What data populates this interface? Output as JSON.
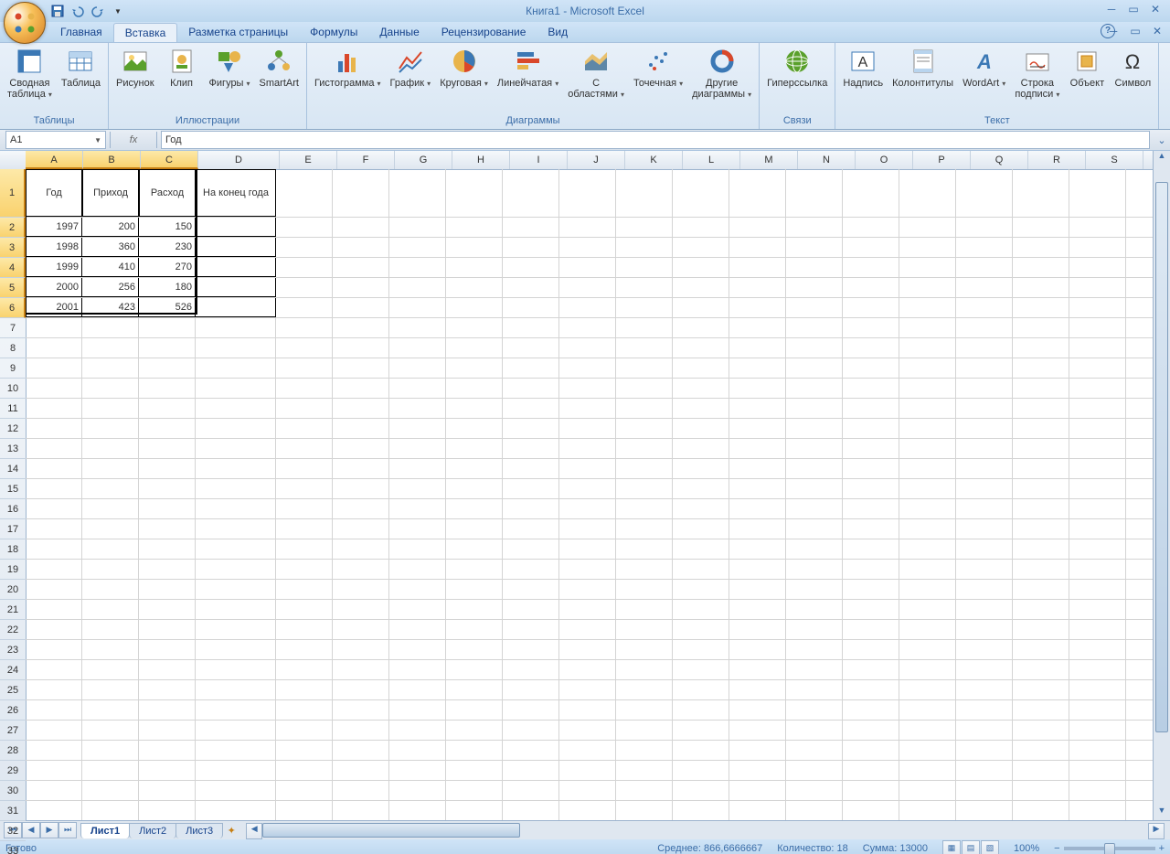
{
  "title": "Книга1 - Microsoft Excel",
  "namebox": "A1",
  "formula": "Год",
  "tabs": [
    "Главная",
    "Вставка",
    "Разметка страницы",
    "Формулы",
    "Данные",
    "Рецензирование",
    "Вид"
  ],
  "active_tab": 1,
  "ribbon_groups": {
    "g1": {
      "label": "Таблицы",
      "buttons": [
        {
          "lbl": "Сводная\nтаблица",
          "dd": true
        },
        {
          "lbl": "Таблица"
        }
      ]
    },
    "g2": {
      "label": "Иллюстрации",
      "buttons": [
        {
          "lbl": "Рисунок"
        },
        {
          "lbl": "Клип"
        },
        {
          "lbl": "Фигуры",
          "dd": true
        },
        {
          "lbl": "SmartArt"
        }
      ]
    },
    "g3": {
      "label": "Диаграммы",
      "buttons": [
        {
          "lbl": "Гистограмма",
          "dd": true
        },
        {
          "lbl": "График",
          "dd": true
        },
        {
          "lbl": "Круговая",
          "dd": true
        },
        {
          "lbl": "Линейчатая",
          "dd": true
        },
        {
          "lbl": "С\nобластями",
          "dd": true
        },
        {
          "lbl": "Точечная",
          "dd": true
        },
        {
          "lbl": "Другие\nдиаграммы",
          "dd": true
        }
      ]
    },
    "g4": {
      "label": "Связи",
      "buttons": [
        {
          "lbl": "Гиперссылка"
        }
      ]
    },
    "g5": {
      "label": "Текст",
      "buttons": [
        {
          "lbl": "Надпись"
        },
        {
          "lbl": "Колонтитулы"
        },
        {
          "lbl": "WordArt",
          "dd": true
        },
        {
          "lbl": "Строка\nподписи",
          "dd": true
        },
        {
          "lbl": "Объект"
        },
        {
          "lbl": "Символ"
        }
      ]
    }
  },
  "columns": [
    "A",
    "B",
    "C",
    "D",
    "E",
    "F",
    "G",
    "H",
    "I",
    "J",
    "K",
    "L",
    "M",
    "N",
    "O",
    "P",
    "Q",
    "R",
    "S"
  ],
  "col_widths": {
    "A": 62,
    "B": 62,
    "C": 62,
    "D": 88,
    "default": 62
  },
  "headers": [
    "Год",
    "Приход",
    "Расход",
    "На конец года"
  ],
  "rows": [
    [
      1997,
      200,
      150,
      ""
    ],
    [
      1998,
      360,
      230,
      ""
    ],
    [
      1999,
      410,
      270,
      ""
    ],
    [
      2000,
      256,
      180,
      ""
    ],
    [
      2001,
      423,
      526,
      ""
    ]
  ],
  "sheet_tabs": [
    "Лист1",
    "Лист2",
    "Лист3"
  ],
  "active_sheet": 0,
  "status": {
    "ready": "Готово",
    "avg_lbl": "Среднее:",
    "avg": "866,6666667",
    "cnt_lbl": "Количество:",
    "cnt": "18",
    "sum_lbl": "Сумма:",
    "sum": "13000",
    "zoom": "100%"
  },
  "selection": {
    "cols": [
      0,
      1,
      2
    ],
    "rows": [
      1,
      2,
      3,
      4,
      5,
      6
    ]
  }
}
